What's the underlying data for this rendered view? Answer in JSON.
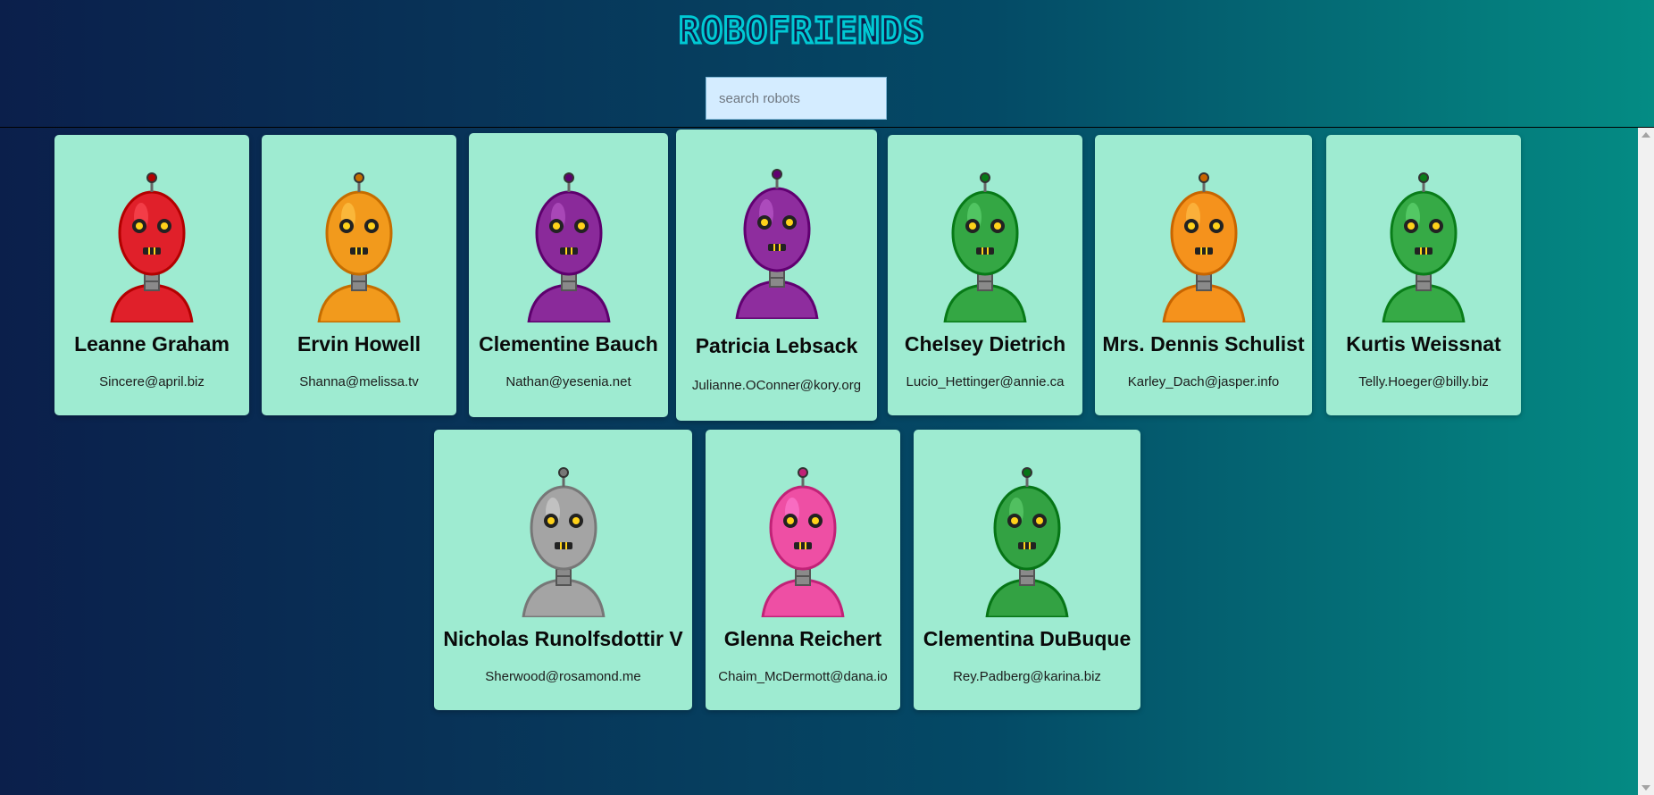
{
  "app": {
    "title": "ROBOFRIENDS"
  },
  "search": {
    "placeholder": "search robots",
    "value": ""
  },
  "robots": [
    {
      "name": "Leanne Graham",
      "email": "Sincere@april.biz",
      "color": "#e0202a"
    },
    {
      "name": "Ervin Howell",
      "email": "Shanna@melissa.tv",
      "color": "#f29a1c"
    },
    {
      "name": "Clementine Bauch",
      "email": "Nathan@yesenia.net",
      "color": "#8a2a9a"
    },
    {
      "name": "Patricia Lebsack",
      "email": "Julianne.OConner@kory.org",
      "color": "#8e2d9e"
    },
    {
      "name": "Chelsey Dietrich",
      "email": "Lucio_Hettinger@annie.ca",
      "color": "#34a744"
    },
    {
      "name": "Mrs. Dennis Schulist",
      "email": "Karley_Dach@jasper.info",
      "color": "#f5921c"
    },
    {
      "name": "Kurtis Weissnat",
      "email": "Telly.Hoeger@billy.biz",
      "color": "#36aa46"
    },
    {
      "name": "Nicholas Runolfsdottir V",
      "email": "Sherwood@rosamond.me",
      "color": "#a4a4a4"
    },
    {
      "name": "Glenna Reichert",
      "email": "Chaim_McDermott@dana.io",
      "color": "#ee4fa4"
    },
    {
      "name": "Clementina DuBuque",
      "email": "Rey.Padberg@karina.biz",
      "color": "#33a243"
    }
  ]
}
